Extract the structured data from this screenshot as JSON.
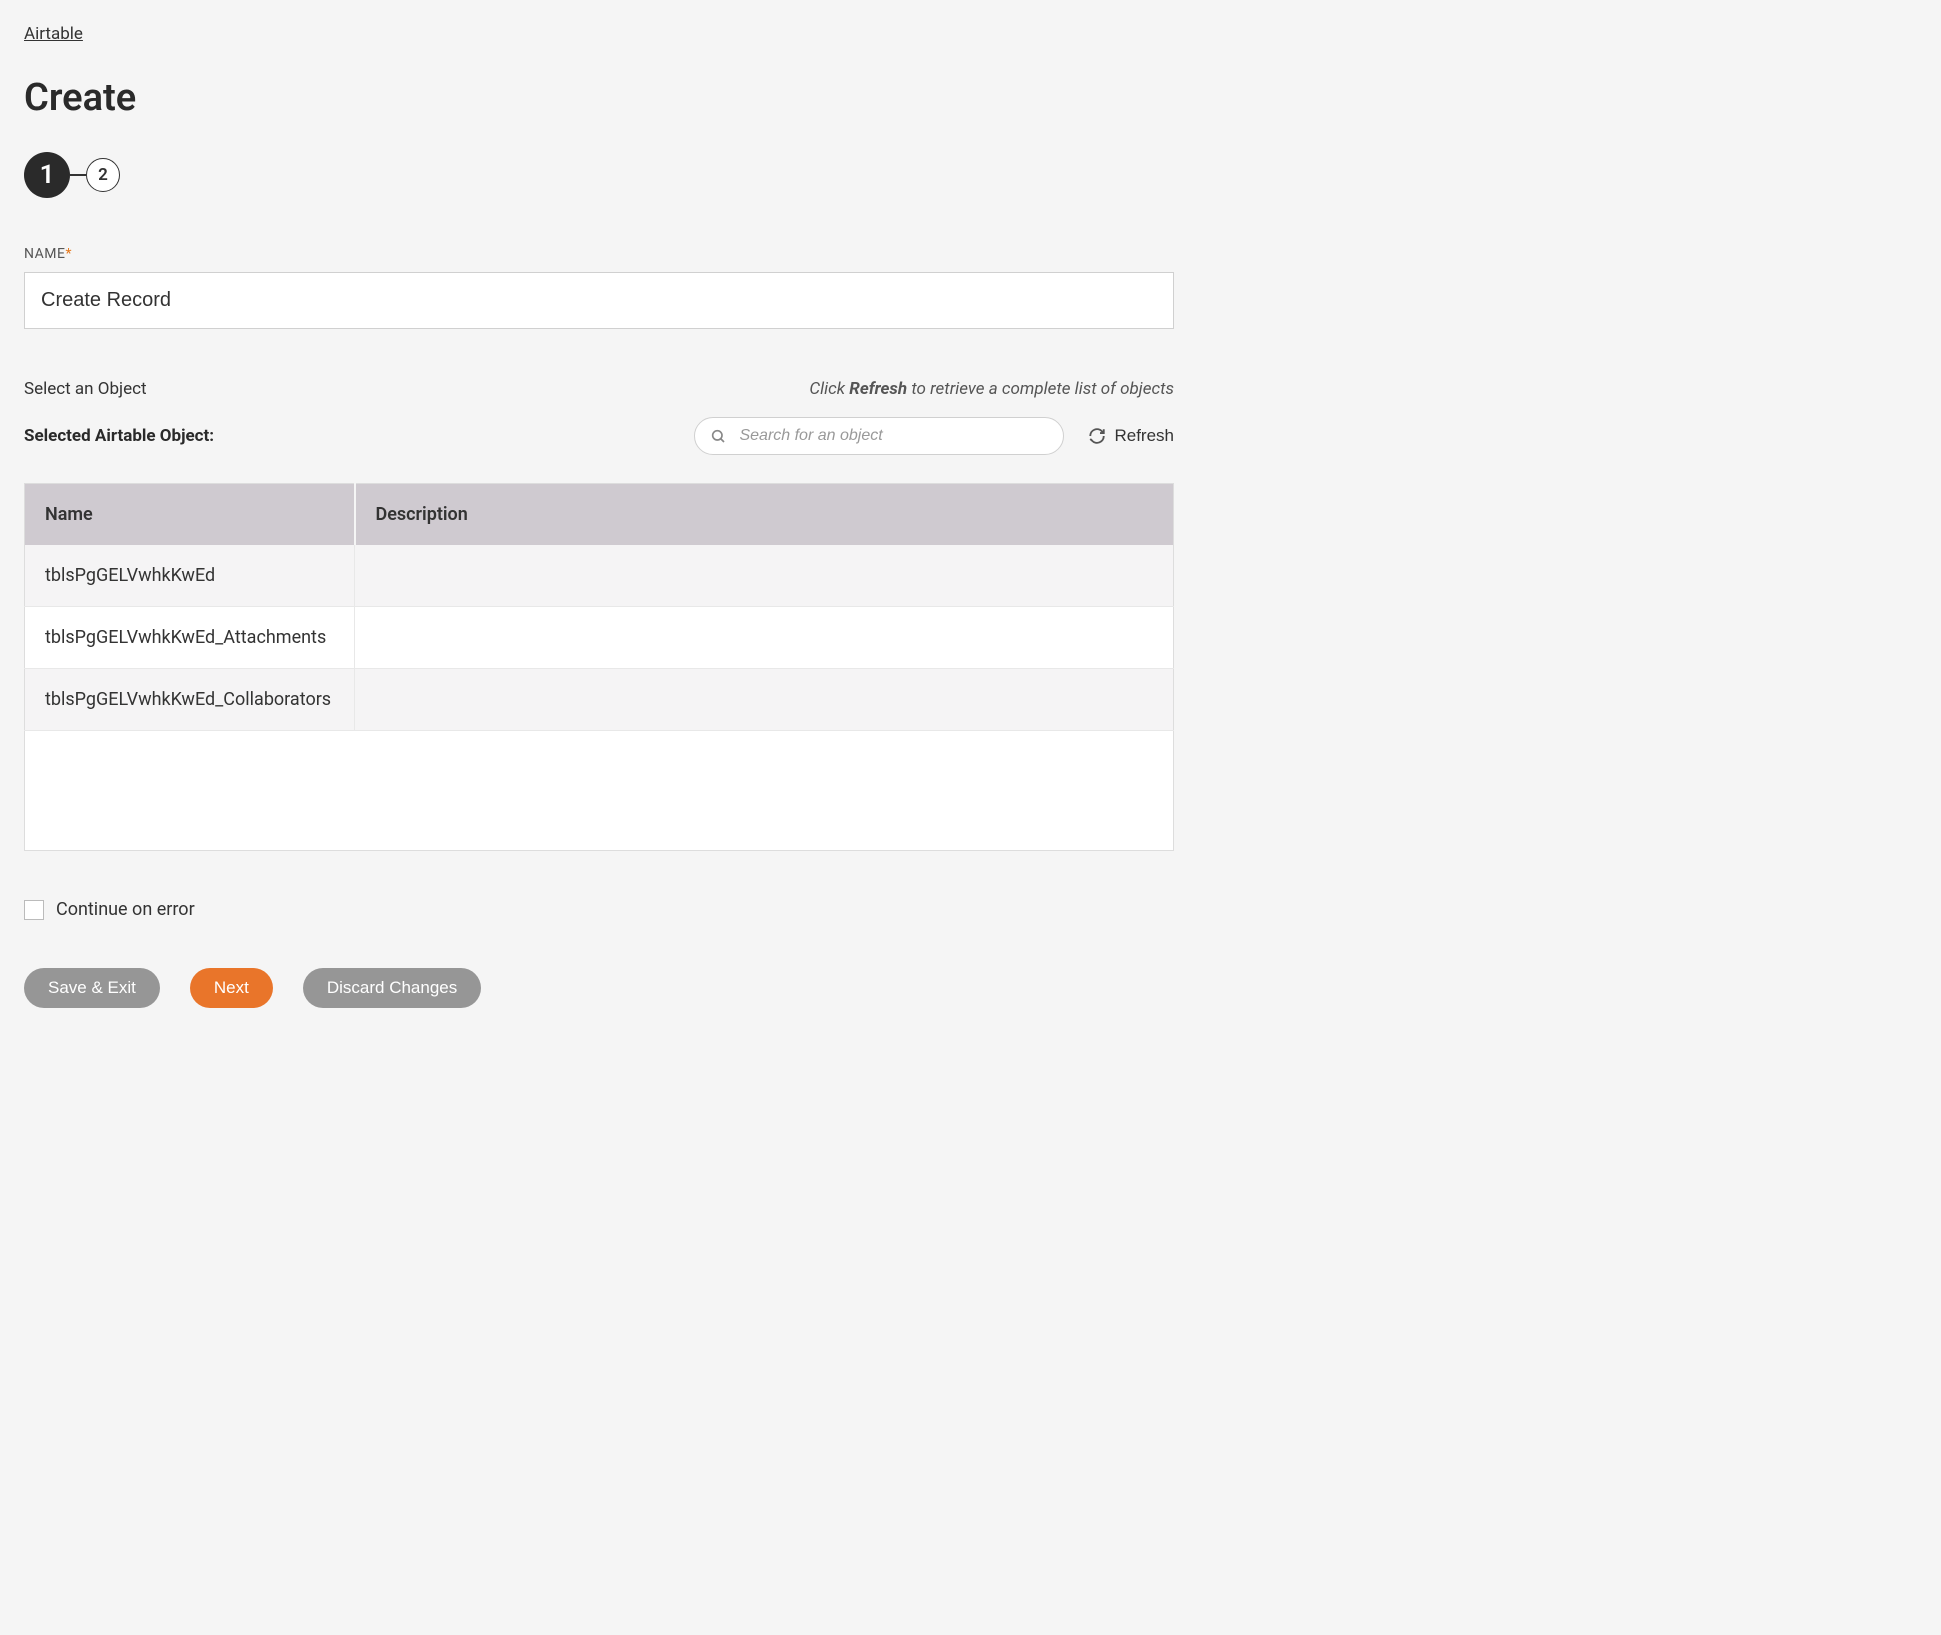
{
  "breadcrumb": {
    "link_label": "Airtable"
  },
  "page": {
    "title": "Create"
  },
  "stepper": {
    "step1": "1",
    "step2": "2"
  },
  "name_field": {
    "label": "NAME",
    "value": "Create Record"
  },
  "object_section": {
    "select_label": "Select an Object",
    "hint_prefix": "Click ",
    "hint_strong": "Refresh",
    "hint_suffix": " to retrieve a complete list of objects",
    "selected_label": "Selected Airtable Object:",
    "search_placeholder": "Search for an object",
    "refresh_label": "Refresh"
  },
  "table": {
    "headers": {
      "name": "Name",
      "description": "Description"
    },
    "rows": [
      {
        "name": "tblsPgGELVwhkKwEd",
        "description": ""
      },
      {
        "name": "tblsPgGELVwhkKwEd_Attachments",
        "description": ""
      },
      {
        "name": "tblsPgGELVwhkKwEd_Collaborators",
        "description": ""
      }
    ]
  },
  "continue_on_error": {
    "label": "Continue on error",
    "checked": false
  },
  "buttons": {
    "save_exit": "Save & Exit",
    "next": "Next",
    "discard": "Discard Changes"
  }
}
